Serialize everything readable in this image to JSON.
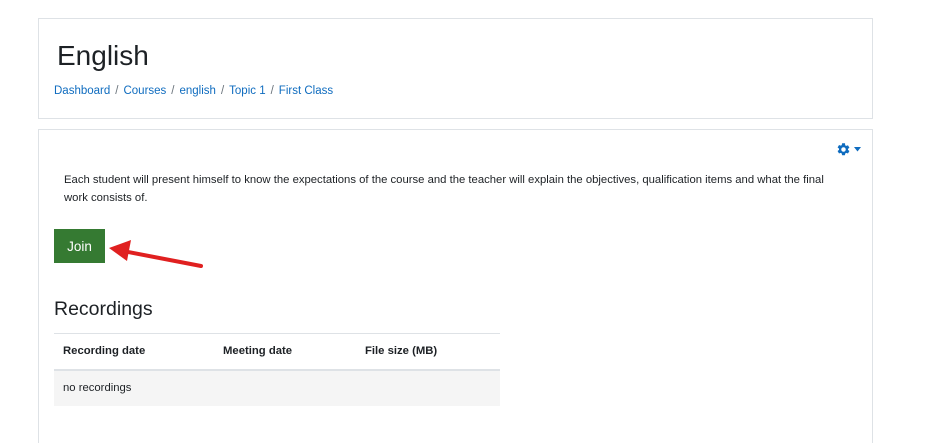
{
  "header": {
    "title": "English",
    "breadcrumb": [
      {
        "label": "Dashboard"
      },
      {
        "label": "Courses"
      },
      {
        "label": "english"
      },
      {
        "label": "Topic 1"
      },
      {
        "label": "First Class"
      }
    ],
    "separator": "/"
  },
  "main": {
    "settings_icon": "gear-icon",
    "description": "Each student will present himself to know the expectations of the course and the teacher will explain the objectives, qualification items and what the final work consists of.",
    "join_label": "Join",
    "join_color": "#357a32",
    "annotation_arrow_color": "#e02020",
    "recordings": {
      "heading": "Recordings",
      "columns": [
        "Recording date",
        "Meeting date",
        "File size (MB)"
      ],
      "empty_text": "no recordings"
    }
  }
}
